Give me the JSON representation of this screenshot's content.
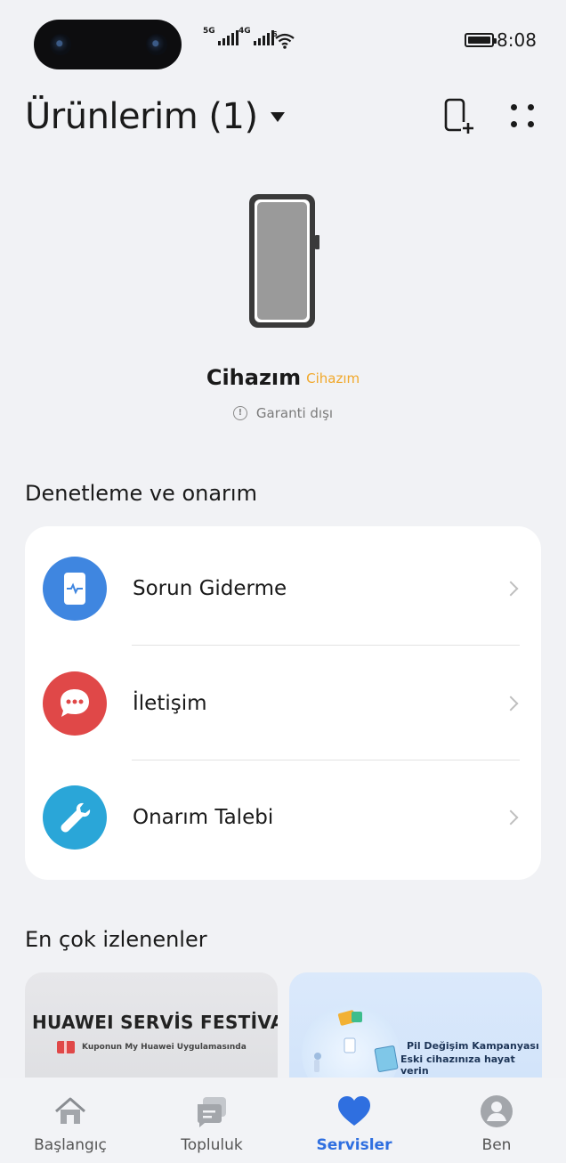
{
  "status_bar": {
    "signal_1": "5G",
    "signal_2": "4G",
    "wifi_label": "6",
    "time": "8:08"
  },
  "header": {
    "title": "Ürünlerim (1)",
    "icons": [
      "add-device-icon",
      "more-icon"
    ]
  },
  "device": {
    "name": "Cihazım",
    "tag": "Cihazım",
    "warranty": "Garanti dışı",
    "tag_color": "#f1a82a"
  },
  "service_section": {
    "title": "Denetleme ve onarım",
    "items": [
      {
        "label": "Sorun Giderme",
        "icon": "phone-diagnose-icon",
        "color": "#3f86e0"
      },
      {
        "label": "İletişim",
        "icon": "chat-bubble-icon",
        "color": "#e04848"
      },
      {
        "label": "Onarım Talebi",
        "icon": "wrench-icon",
        "color": "#2aa6d8"
      }
    ]
  },
  "popular_section": {
    "title": "En çok izlenenler",
    "banners": [
      {
        "headline": "HUAWEI SERVİS FESTİVALİ",
        "subtitle": "Kuponun My Huawei Uygulamasında"
      },
      {
        "line1": "Pil Değişim Kampanyası",
        "line2": "Eski cihazınıza hayat verin"
      }
    ]
  },
  "bottom_nav": {
    "tabs": [
      {
        "label": "Başlangıç",
        "icon": "home-icon",
        "active": false
      },
      {
        "label": "Topluluk",
        "icon": "community-icon",
        "active": false
      },
      {
        "label": "Servisler",
        "icon": "heart-icon",
        "active": true
      },
      {
        "label": "Ben",
        "icon": "profile-icon",
        "active": false
      }
    ],
    "active_color": "#2f6fe0"
  }
}
